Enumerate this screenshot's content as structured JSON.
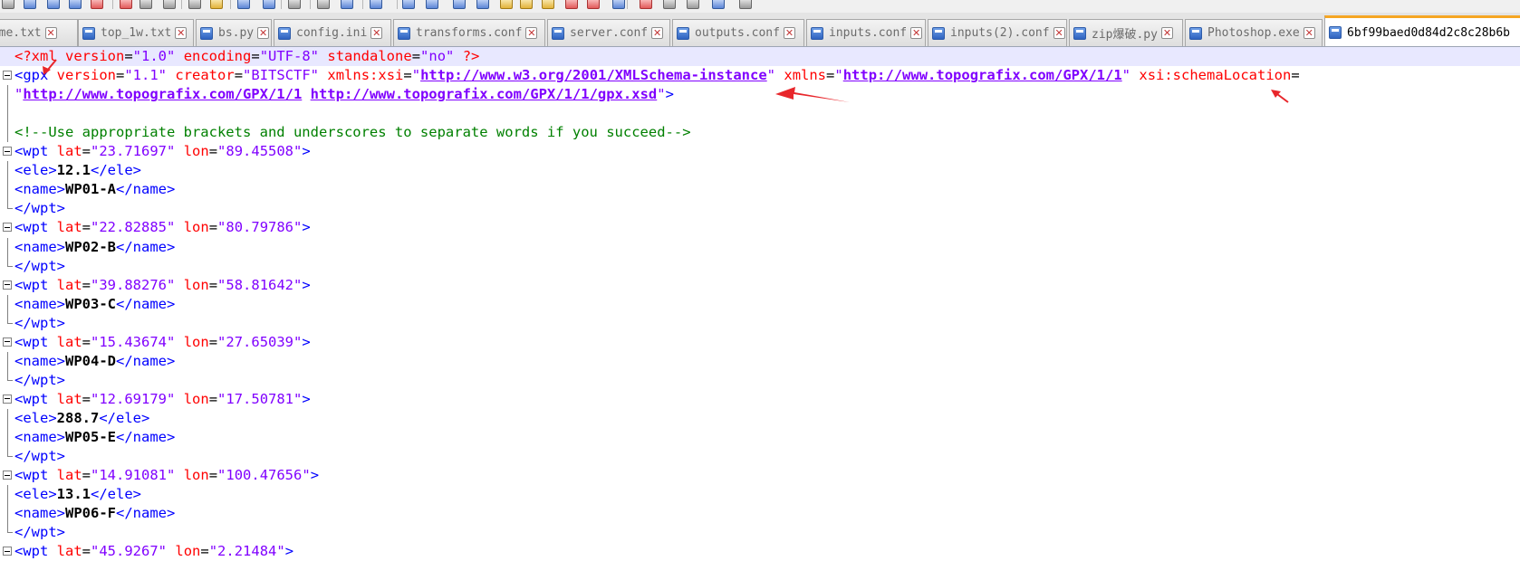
{
  "tabs": [
    {
      "label": "home.txt",
      "active": false
    },
    {
      "label": "top_1w.txt",
      "active": false
    },
    {
      "label": "bs.py",
      "active": false
    },
    {
      "label": "config.ini",
      "active": false
    },
    {
      "label": "transforms.conf",
      "active": false
    },
    {
      "label": "server.conf",
      "active": false
    },
    {
      "label": "outputs.conf",
      "active": false
    },
    {
      "label": "inputs.conf",
      "active": false
    },
    {
      "label": "inputs(2).conf",
      "active": false
    },
    {
      "label": "zip爆破.py",
      "active": false
    },
    {
      "label": "Photoshop.exe",
      "active": false
    },
    {
      "label": "6bf99baed0d84d2c8c28b6b",
      "active": true
    }
  ],
  "tab_close_glyph": "✕",
  "editor_lines": [
    {
      "fold": "",
      "highlight": true,
      "tokens": [
        [
          "pi",
          "<?xml "
        ],
        [
          "attr",
          "version"
        ],
        [
          "plain",
          "="
        ],
        [
          "val",
          "\"1.0\""
        ],
        [
          "plain",
          " "
        ],
        [
          "attr",
          "encoding"
        ],
        [
          "plain",
          "="
        ],
        [
          "val",
          "\"UTF-8\""
        ],
        [
          "plain",
          " "
        ],
        [
          "attr",
          "standalone"
        ],
        [
          "plain",
          "="
        ],
        [
          "val",
          "\"no\""
        ],
        [
          "plain",
          " "
        ],
        [
          "pi",
          "?>"
        ]
      ]
    },
    {
      "fold": "box",
      "tokens": [
        [
          "tag",
          "<gpx "
        ],
        [
          "attr",
          "version"
        ],
        [
          "plain",
          "="
        ],
        [
          "val",
          "\"1.1\""
        ],
        [
          "plain",
          " "
        ],
        [
          "attr",
          "creator"
        ],
        [
          "plain",
          "="
        ],
        [
          "val",
          "\"BITSCTF\""
        ],
        [
          "plain",
          " "
        ],
        [
          "attr",
          "xmlns:xsi"
        ],
        [
          "plain",
          "="
        ],
        [
          "val",
          "\""
        ],
        [
          "link",
          "http://www.w3.org/2001/XMLSchema-instance"
        ],
        [
          "val",
          "\""
        ],
        [
          "plain",
          " "
        ],
        [
          "attr",
          "xmlns"
        ],
        [
          "plain",
          "="
        ],
        [
          "val",
          "\""
        ],
        [
          "link",
          "http://www.topografix.com/GPX/1/1"
        ],
        [
          "val",
          "\""
        ],
        [
          "plain",
          " "
        ],
        [
          "attr",
          "xsi:schemaLocation"
        ],
        [
          "plain",
          "="
        ]
      ]
    },
    {
      "fold": "vline",
      "tokens": [
        [
          "val",
          "\""
        ],
        [
          "link",
          "http://www.topografix.com/GPX/1/1"
        ],
        [
          "val",
          " "
        ],
        [
          "link",
          "http://www.topografix.com/GPX/1/1/gpx.xsd"
        ],
        [
          "val",
          "\""
        ],
        [
          "tag",
          ">"
        ]
      ]
    },
    {
      "fold": "vline",
      "tokens": []
    },
    {
      "fold": "vline",
      "tokens": [
        [
          "comment",
          "<!--Use appropriate brackets and underscores to separate words if you succeed-->"
        ]
      ]
    },
    {
      "fold": "box",
      "tokens": [
        [
          "tag",
          "<wpt "
        ],
        [
          "attr",
          "lat"
        ],
        [
          "plain",
          "="
        ],
        [
          "val",
          "\"23.71697\""
        ],
        [
          "plain",
          " "
        ],
        [
          "attr",
          "lon"
        ],
        [
          "plain",
          "="
        ],
        [
          "val",
          "\"89.45508\""
        ],
        [
          "tag",
          ">"
        ]
      ]
    },
    {
      "fold": "vline",
      "tokens": [
        [
          "tag",
          "<ele>"
        ],
        [
          "text",
          "12.1"
        ],
        [
          "tag",
          "</ele>"
        ]
      ]
    },
    {
      "fold": "vline",
      "tokens": [
        [
          "tag",
          "<name>"
        ],
        [
          "text",
          "WP01-A"
        ],
        [
          "tag",
          "</name>"
        ]
      ]
    },
    {
      "fold": "end",
      "tokens": [
        [
          "tag",
          "</wpt>"
        ]
      ]
    },
    {
      "fold": "box",
      "tokens": [
        [
          "tag",
          "<wpt "
        ],
        [
          "attr",
          "lat"
        ],
        [
          "plain",
          "="
        ],
        [
          "val",
          "\"22.82885\""
        ],
        [
          "plain",
          " "
        ],
        [
          "attr",
          "lon"
        ],
        [
          "plain",
          "="
        ],
        [
          "val",
          "\"80.79786\""
        ],
        [
          "tag",
          ">"
        ]
      ]
    },
    {
      "fold": "vline",
      "tokens": [
        [
          "tag",
          "<name>"
        ],
        [
          "text",
          "WP02-B"
        ],
        [
          "tag",
          "</name>"
        ]
      ]
    },
    {
      "fold": "end",
      "tokens": [
        [
          "tag",
          "</wpt>"
        ]
      ]
    },
    {
      "fold": "box",
      "tokens": [
        [
          "tag",
          "<wpt "
        ],
        [
          "attr",
          "lat"
        ],
        [
          "plain",
          "="
        ],
        [
          "val",
          "\"39.88276\""
        ],
        [
          "plain",
          " "
        ],
        [
          "attr",
          "lon"
        ],
        [
          "plain",
          "="
        ],
        [
          "val",
          "\"58.81642\""
        ],
        [
          "tag",
          ">"
        ]
      ]
    },
    {
      "fold": "vline",
      "tokens": [
        [
          "tag",
          "<name>"
        ],
        [
          "text",
          "WP03-C"
        ],
        [
          "tag",
          "</name>"
        ]
      ]
    },
    {
      "fold": "end",
      "tokens": [
        [
          "tag",
          "</wpt>"
        ]
      ]
    },
    {
      "fold": "box",
      "tokens": [
        [
          "tag",
          "<wpt "
        ],
        [
          "attr",
          "lat"
        ],
        [
          "plain",
          "="
        ],
        [
          "val",
          "\"15.43674\""
        ],
        [
          "plain",
          " "
        ],
        [
          "attr",
          "lon"
        ],
        [
          "plain",
          "="
        ],
        [
          "val",
          "\"27.65039\""
        ],
        [
          "tag",
          ">"
        ]
      ]
    },
    {
      "fold": "vline",
      "tokens": [
        [
          "tag",
          "<name>"
        ],
        [
          "text",
          "WP04-D"
        ],
        [
          "tag",
          "</name>"
        ]
      ]
    },
    {
      "fold": "end",
      "tokens": [
        [
          "tag",
          "</wpt>"
        ]
      ]
    },
    {
      "fold": "box",
      "tokens": [
        [
          "tag",
          "<wpt "
        ],
        [
          "attr",
          "lat"
        ],
        [
          "plain",
          "="
        ],
        [
          "val",
          "\"12.69179\""
        ],
        [
          "plain",
          " "
        ],
        [
          "attr",
          "lon"
        ],
        [
          "plain",
          "="
        ],
        [
          "val",
          "\"17.50781\""
        ],
        [
          "tag",
          ">"
        ]
      ]
    },
    {
      "fold": "vline",
      "tokens": [
        [
          "tag",
          "<ele>"
        ],
        [
          "text",
          "288.7"
        ],
        [
          "tag",
          "</ele>"
        ]
      ]
    },
    {
      "fold": "vline",
      "tokens": [
        [
          "tag",
          "<name>"
        ],
        [
          "text",
          "WP05-E"
        ],
        [
          "tag",
          "</name>"
        ]
      ]
    },
    {
      "fold": "end",
      "tokens": [
        [
          "tag",
          "</wpt>"
        ]
      ]
    },
    {
      "fold": "box",
      "tokens": [
        [
          "tag",
          "<wpt "
        ],
        [
          "attr",
          "lat"
        ],
        [
          "plain",
          "="
        ],
        [
          "val",
          "\"14.91081\""
        ],
        [
          "plain",
          " "
        ],
        [
          "attr",
          "lon"
        ],
        [
          "plain",
          "="
        ],
        [
          "val",
          "\"100.47656\""
        ],
        [
          "tag",
          ">"
        ]
      ]
    },
    {
      "fold": "vline",
      "tokens": [
        [
          "tag",
          "<ele>"
        ],
        [
          "text",
          "13.1"
        ],
        [
          "tag",
          "</ele>"
        ]
      ]
    },
    {
      "fold": "vline",
      "tokens": [
        [
          "tag",
          "<name>"
        ],
        [
          "text",
          "WP06-F"
        ],
        [
          "tag",
          "</name>"
        ]
      ]
    },
    {
      "fold": "end",
      "tokens": [
        [
          "tag",
          "</wpt>"
        ]
      ]
    },
    {
      "fold": "box",
      "tokens": [
        [
          "tag",
          "<wpt "
        ],
        [
          "attr",
          "lat"
        ],
        [
          "plain",
          "="
        ],
        [
          "val",
          "\"45.9267\""
        ],
        [
          "plain",
          " "
        ],
        [
          "attr",
          "lon"
        ],
        [
          "plain",
          "="
        ],
        [
          "val",
          "\"2.21484\""
        ],
        [
          "tag",
          ">"
        ]
      ]
    }
  ],
  "colors": {
    "tag": "#0000ff",
    "attribute": "#ff0000",
    "value": "#8000ff",
    "comment": "#008000",
    "text": "#000000",
    "annotation_arrow": "#e8262b",
    "active_tab_accent": "#f5a623"
  },
  "icons": [
    "new-file-icon",
    "open-file-icon",
    "save-icon",
    "save-all-icon",
    "close-icon",
    "close-all-icon",
    "print-icon",
    "cut-icon",
    "copy-icon",
    "paste-icon",
    "undo-icon",
    "redo-icon",
    "find-icon",
    "replace-icon",
    "zoom-in-icon",
    "zoom-out-icon",
    "sync-vertical-icon",
    "sync-horizontal-icon",
    "word-wrap-icon",
    "show-all-chars-icon",
    "indent-guide-icon",
    "user-lang-icon",
    "doc-map-icon",
    "function-list-icon",
    "folder-workspace-icon",
    "monitoring-icon",
    "record-macro-icon",
    "stop-record-icon",
    "play-macro-icon",
    "run-macro-multiple-icon",
    "save-macro-icon"
  ]
}
